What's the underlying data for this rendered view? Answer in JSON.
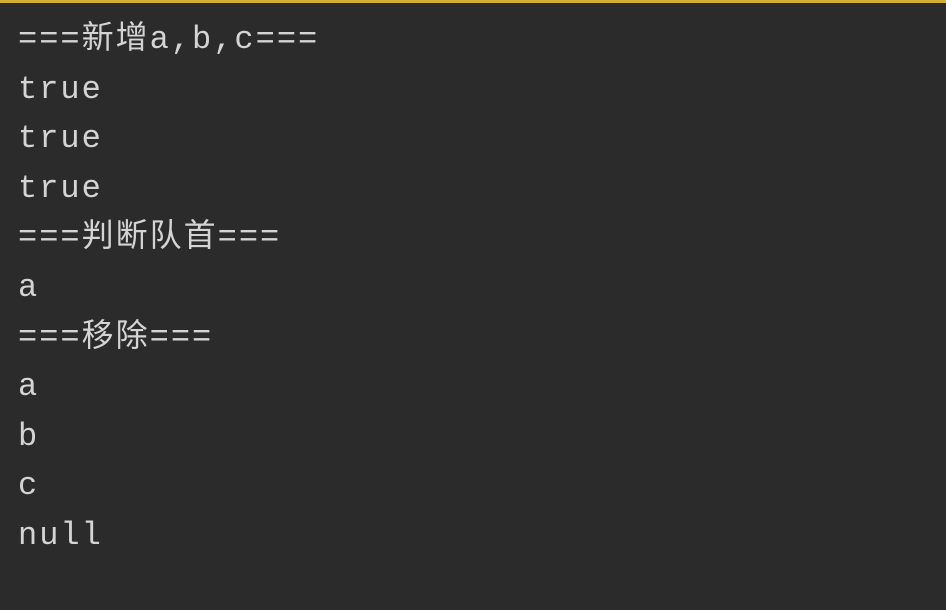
{
  "console": {
    "lines": [
      "===新增a,b,c===",
      "true",
      "true",
      "true",
      "===判断队首===",
      "a",
      "===移除===",
      "a",
      "b",
      "c",
      "null"
    ]
  }
}
